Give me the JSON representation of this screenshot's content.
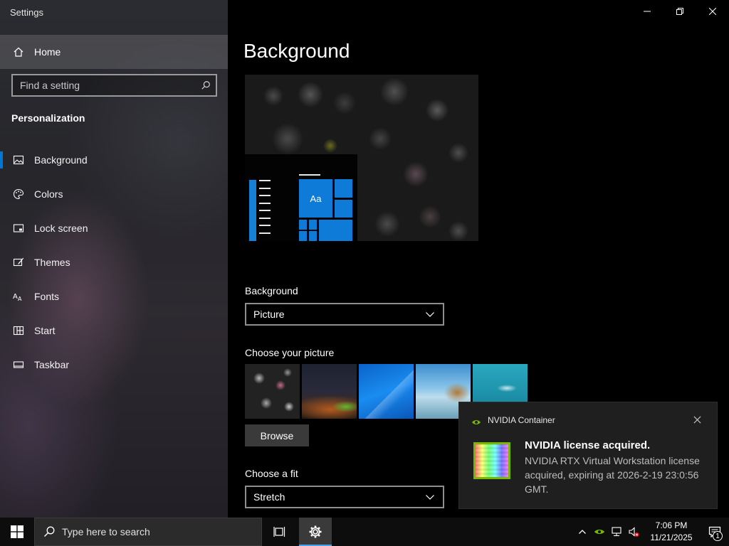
{
  "window": {
    "title": "Settings",
    "controls": [
      "minimize",
      "restore",
      "close"
    ]
  },
  "sidebar": {
    "home_label": "Home",
    "search_placeholder": "Find a setting",
    "section_title": "Personalization",
    "items": [
      {
        "label": "Background",
        "icon": "picture-icon",
        "active": true
      },
      {
        "label": "Colors",
        "icon": "palette-icon",
        "active": false
      },
      {
        "label": "Lock screen",
        "icon": "lock-screen-icon",
        "active": false
      },
      {
        "label": "Themes",
        "icon": "themes-brush-icon",
        "active": false
      },
      {
        "label": "Fonts",
        "icon": "fonts-icon",
        "active": false
      },
      {
        "label": "Start",
        "icon": "start-grid-icon",
        "active": false
      },
      {
        "label": "Taskbar",
        "icon": "taskbar-icon",
        "active": false
      }
    ]
  },
  "main": {
    "title": "Background",
    "preview_tile_text": "Aa",
    "background_label": "Background",
    "background_value": "Picture",
    "choose_picture_label": "Choose your picture",
    "thumbnails": [
      "cats-wallpaper",
      "night-sky",
      "windows-blue",
      "beach-rocks",
      "underwater-swimmer"
    ],
    "browse_label": "Browse",
    "choose_fit_label": "Choose a fit",
    "fit_value": "Stretch"
  },
  "toast": {
    "app_name": "NVIDIA Container",
    "title": "NVIDIA license acquired.",
    "body": "NVIDIA RTX Virtual Workstation license acquired, expiring at 2026-2-19 23:0:56 GMT."
  },
  "taskbar": {
    "search_placeholder": "Type here to search",
    "time": "7:06 PM",
    "date": "11/21/2025",
    "notification_count": "1"
  },
  "colors": {
    "accent": "#0078d7",
    "nvidia_green": "#76b900"
  }
}
